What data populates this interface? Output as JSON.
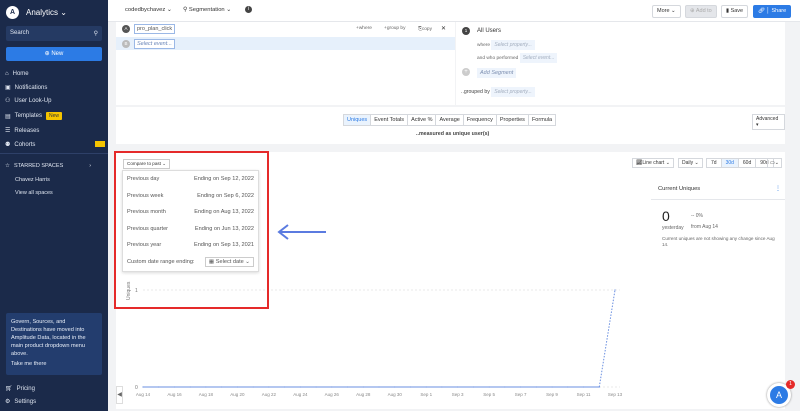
{
  "sidebar": {
    "app": "Analytics",
    "search": "Search",
    "new": "New",
    "items": [
      {
        "label": "Home",
        "icon": "home-icon"
      },
      {
        "label": "Notifications",
        "icon": "inbox-icon"
      },
      {
        "label": "User Look-Up",
        "icon": "user-search-icon"
      },
      {
        "label": "Templates",
        "icon": "template-icon",
        "badge": "New"
      },
      {
        "label": "Releases",
        "icon": "releases-icon"
      },
      {
        "label": "Cohorts",
        "icon": "cohorts-icon"
      }
    ],
    "starred": "STARRED SPACES",
    "spaces": [
      "Chavez Harris",
      "View all spaces"
    ],
    "notice": "Govern, Sources, and Destinations have moved into Amplitude Data, located in the main product dropdown menu above.",
    "notice_link": "Take me there",
    "pricing": "Pricing",
    "settings": "Settings"
  },
  "top": {
    "org": "codedbychavez",
    "chart_type": "Segmentation",
    "more": "More",
    "add_to": "Add to",
    "save": "Save",
    "share": "Share"
  },
  "events": {
    "rows": [
      {
        "letter": "A",
        "value": "pro_plan_click"
      },
      {
        "letter": "B",
        "value": "Select event..."
      }
    ],
    "where": "where",
    "group_by": "group by",
    "copy": "copy"
  },
  "segment": {
    "num": "1",
    "name": "All Users",
    "where": "where",
    "where_ph": "Select property...",
    "performed": "and who performed",
    "performed_ph": "Select event...",
    "add": "Add Segment",
    "grouped": "..grouped by",
    "grouped_ph": "Select property..."
  },
  "metrics": {
    "tabs": [
      "Uniques",
      "Event Totals",
      "Active %",
      "Average",
      "Frequency",
      "Properties",
      "Formula"
    ],
    "selected": "Uniques",
    "measured": "..measured as unique user(s)",
    "advanced": "Advanced"
  },
  "compare": {
    "label": "Compare to past",
    "options": [
      {
        "label": "Previous day",
        "end": "Ending on Sep 12, 2022"
      },
      {
        "label": "Previous week",
        "end": "Ending on Sep 6, 2022"
      },
      {
        "label": "Previous month",
        "end": "Ending on Aug 13, 2022"
      },
      {
        "label": "Previous quarter",
        "end": "Ending on Jun 13, 2022"
      },
      {
        "label": "Previous year",
        "end": "Ending on Sep 13, 2021"
      }
    ],
    "custom": "Custom date range ending:",
    "select_date": "Select date"
  },
  "controls": {
    "chart": "Line chart",
    "interval": "Daily",
    "ranges": [
      "7d",
      "30d",
      "60d",
      "90d"
    ],
    "selected_range": "30d"
  },
  "current": {
    "title": "Current Uniques",
    "value": "0",
    "period": "yesterday",
    "change": "-- 0%",
    "from": "from Aug 14",
    "note": "Current uniques are not showing any change since Aug 14."
  },
  "chart_data": {
    "type": "line",
    "ylabel": "Uniques",
    "yticks": [
      "0",
      "1"
    ],
    "ylim": [
      0,
      1
    ],
    "xticks": [
      "Aug 14",
      "Aug 16",
      "Aug 18",
      "Aug 20",
      "Aug 22",
      "Aug 24",
      "Aug 26",
      "Aug 28",
      "Aug 30",
      "Sep 1",
      "Sep 3",
      "Sep 5",
      "Sep 7",
      "Sep 9",
      "Sep 11",
      "Sep 13"
    ],
    "x": [
      "Aug 14",
      "Aug 15",
      "Aug 16",
      "Aug 17",
      "Aug 18",
      "Aug 19",
      "Aug 20",
      "Aug 21",
      "Aug 22",
      "Aug 23",
      "Aug 24",
      "Aug 25",
      "Aug 26",
      "Aug 27",
      "Aug 28",
      "Aug 29",
      "Aug 30",
      "Aug 31",
      "Sep 1",
      "Sep 2",
      "Sep 3",
      "Sep 4",
      "Sep 5",
      "Sep 6",
      "Sep 7",
      "Sep 8",
      "Sep 9",
      "Sep 10",
      "Sep 11",
      "Sep 12",
      "Sep 13"
    ],
    "values": [
      0,
      0,
      0,
      0,
      0,
      0,
      0,
      0,
      0,
      0,
      0,
      0,
      0,
      0,
      0,
      0,
      0,
      0,
      0,
      0,
      0,
      0,
      0,
      0,
      0,
      0,
      0,
      0,
      0,
      0,
      1
    ],
    "color": "#6a8fe0"
  },
  "annotation_color": "#e52a2a",
  "arrow_color": "#5b7be0",
  "help_badge": "1"
}
